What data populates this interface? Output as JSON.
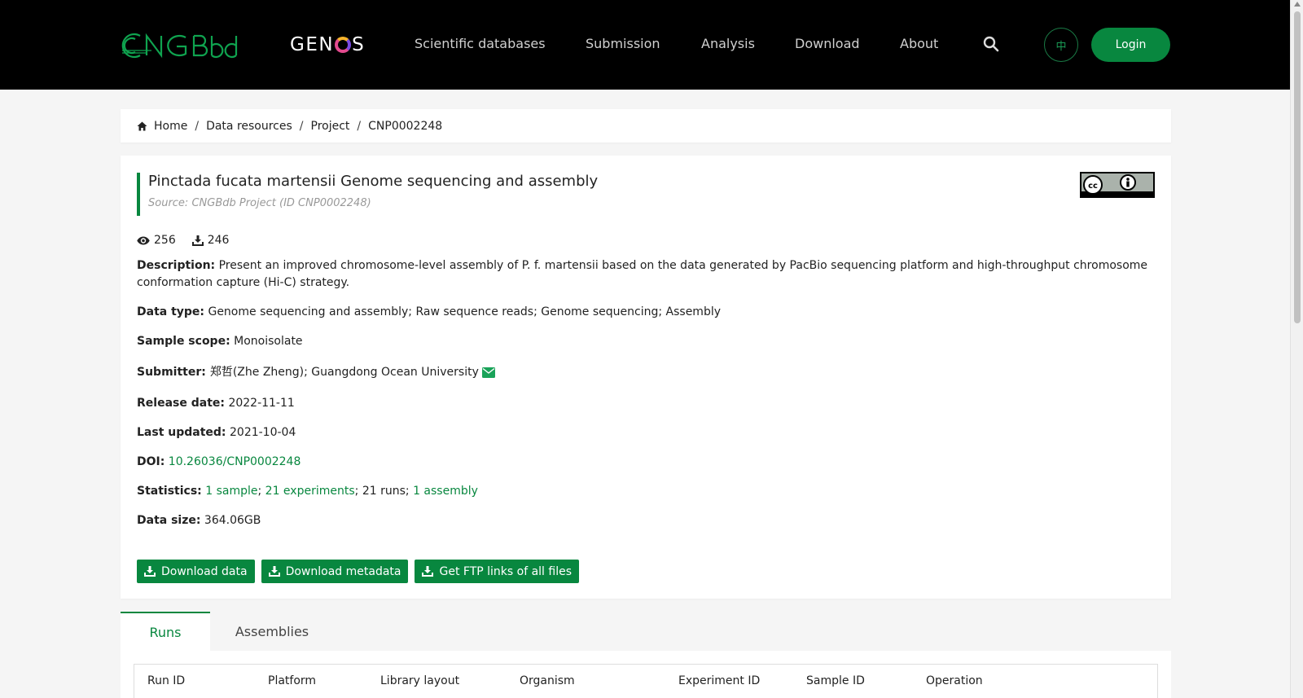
{
  "header": {
    "genos_prefix": "GEN",
    "genos_suffix": "S",
    "nav": [
      "Scientific databases",
      "Submission",
      "Analysis",
      "Download",
      "About"
    ],
    "lang": "中",
    "login": "Login"
  },
  "breadcrumb": [
    "Home",
    "Data resources",
    "Project",
    "CNP0002248"
  ],
  "project": {
    "title": "Pinctada fucata martensii Genome sequencing and assembly",
    "source": "Source: CNGBdb Project (ID CNP0002248)",
    "views": "256",
    "downloads": "246",
    "description_label": "Description:",
    "description": "Present an improved chromosome-level assembly of P. f. martensii based on the data generated by PacBio sequencing platform and high-throughput chromosome conformation capture (Hi-C) strategy.",
    "data_type_label": "Data type:",
    "data_type": "Genome sequencing and assembly; Raw sequence reads; Genome sequencing; Assembly",
    "sample_scope_label": "Sample scope:",
    "sample_scope": "Monoisolate",
    "submitter_label": "Submitter:",
    "submitter": "郑哲(Zhe Zheng); Guangdong Ocean University",
    "release_label": "Release date:",
    "release_date": "2022-11-11",
    "updated_label": "Last updated:",
    "last_updated": "2021-10-04",
    "doi_label": "DOI:",
    "doi": "10.26036/CNP0002248",
    "statistics_label": "Statistics:",
    "stat_samples": "1 sample",
    "stat_experiments": "21 experiments",
    "stat_runs": "21 runs",
    "stat_assembly": "1 assembly",
    "datasize_label": "Data size:",
    "data_size": "364.06GB",
    "buttons": [
      "Download data",
      "Download metadata",
      "Get FTP links of all files"
    ]
  },
  "tabs": [
    "Runs",
    "Assemblies"
  ],
  "table_headers": [
    "Run ID",
    "Platform",
    "Library layout",
    "Organism",
    "Experiment ID",
    "Sample ID",
    "Operation"
  ],
  "colors": {
    "brand_green": "#08873f",
    "header_bg": "#000000"
  }
}
